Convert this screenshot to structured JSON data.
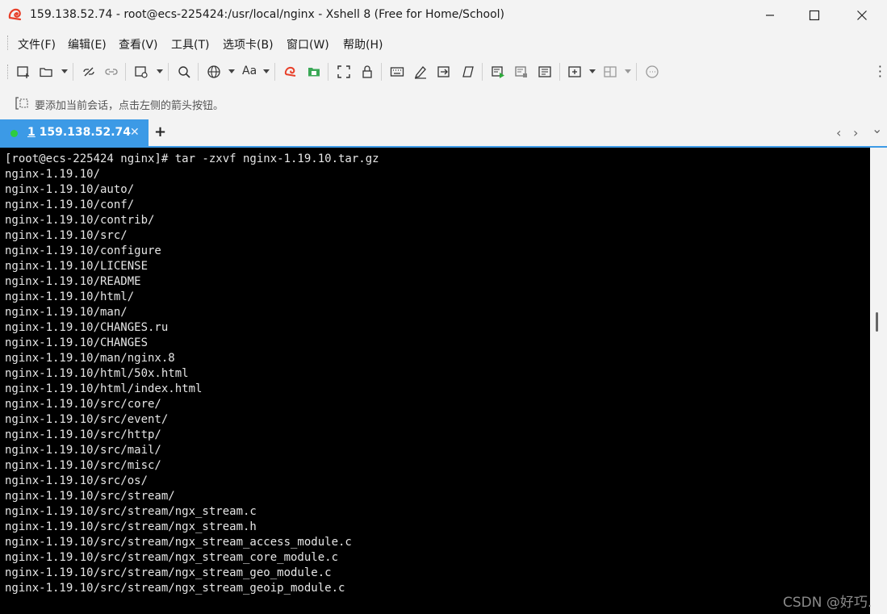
{
  "window": {
    "title": "159.138.52.74 - root@ecs-225424:/usr/local/nginx - Xshell 8 (Free for Home/School)",
    "icons": {
      "app": "xshell-logo",
      "minimize": "minimize-icon",
      "maximize": "maximize-icon",
      "close": "close-icon"
    }
  },
  "menu": [
    {
      "label": "文件(F)"
    },
    {
      "label": "编辑(E)"
    },
    {
      "label": "查看(V)"
    },
    {
      "label": "工具(T)"
    },
    {
      "label": "选项卡(B)"
    },
    {
      "label": "窗口(W)"
    },
    {
      "label": "帮助(H)"
    }
  ],
  "toolbar": {
    "font_button_label": "Aa",
    "icons": [
      "new-session-icon",
      "open-folder-icon",
      "disconnect-icon",
      "reconnect-icon",
      "session-props-icon",
      "search-icon",
      "globe-icon",
      "font-icon",
      "xshell-icon",
      "xftp-icon",
      "fullscreen-icon",
      "lock-icon",
      "keyboard-icon",
      "compose-icon",
      "transfer-icon",
      "script-icon",
      "macro-run-icon",
      "log-icon",
      "notes-icon",
      "new-tab-icon",
      "layout-icon",
      "chat-icon",
      "more-icon"
    ]
  },
  "hint": {
    "text": "要添加当前会话，点击左侧的箭头按钮。"
  },
  "tabs": [
    {
      "number": "1",
      "label": " 159.138.52.74",
      "status": "connected"
    }
  ],
  "tab_controls": {
    "add": "+",
    "prev": "‹",
    "next": "›",
    "menu": "⌄"
  },
  "terminal": {
    "lines": [
      "[root@ecs-225424 nginx]# tar -zxvf nginx-1.19.10.tar.gz",
      "nginx-1.19.10/",
      "nginx-1.19.10/auto/",
      "nginx-1.19.10/conf/",
      "nginx-1.19.10/contrib/",
      "nginx-1.19.10/src/",
      "nginx-1.19.10/configure",
      "nginx-1.19.10/LICENSE",
      "nginx-1.19.10/README",
      "nginx-1.19.10/html/",
      "nginx-1.19.10/man/",
      "nginx-1.19.10/CHANGES.ru",
      "nginx-1.19.10/CHANGES",
      "nginx-1.19.10/man/nginx.8",
      "nginx-1.19.10/html/50x.html",
      "nginx-1.19.10/html/index.html",
      "nginx-1.19.10/src/core/",
      "nginx-1.19.10/src/event/",
      "nginx-1.19.10/src/http/",
      "nginx-1.19.10/src/mail/",
      "nginx-1.19.10/src/misc/",
      "nginx-1.19.10/src/os/",
      "nginx-1.19.10/src/stream/",
      "nginx-1.19.10/src/stream/ngx_stream.c",
      "nginx-1.19.10/src/stream/ngx_stream.h",
      "nginx-1.19.10/src/stream/ngx_stream_access_module.c",
      "nginx-1.19.10/src/stream/ngx_stream_core_module.c",
      "nginx-1.19.10/src/stream/ngx_stream_geo_module.c",
      "nginx-1.19.10/src/stream/ngx_stream_geoip_module.c"
    ]
  },
  "watermark": "CSDN @好巧."
}
